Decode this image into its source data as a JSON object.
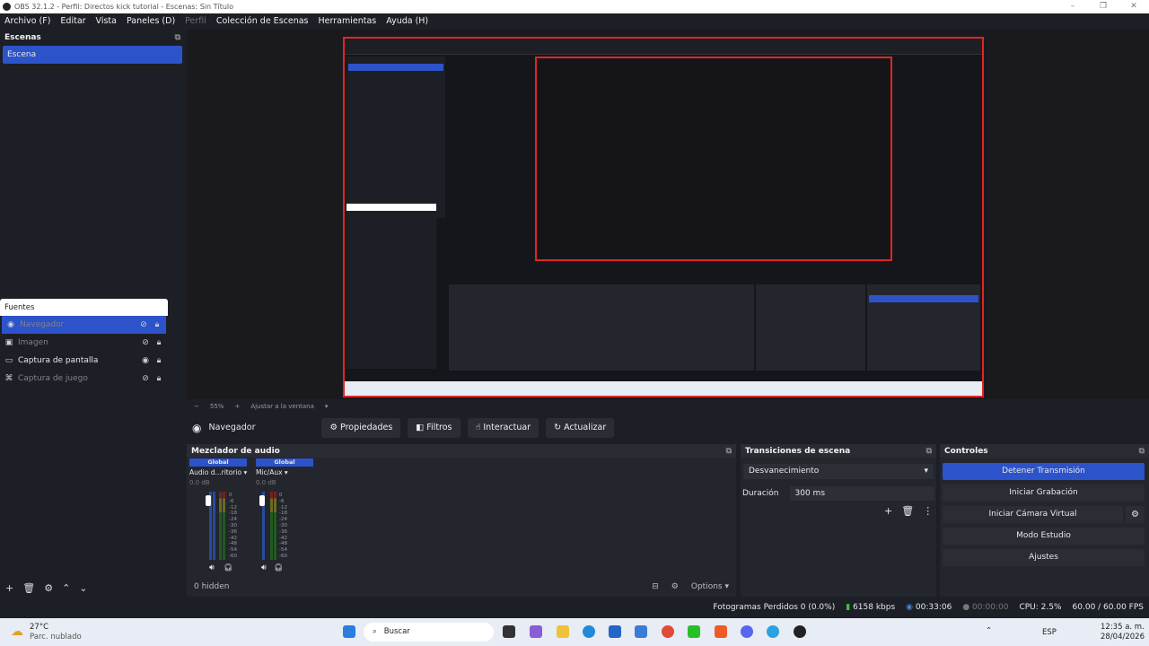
{
  "window": {
    "title": "OBS 32.1.2 - Perfil: Directos kick tutorial - Escenas: Sin Título",
    "controls": [
      "–",
      "❐",
      "✕"
    ]
  },
  "menu": {
    "items": [
      "Archivo (F)",
      "Editar",
      "Vista",
      "Paneles (D)",
      "Perfil",
      "Colección de Escenas",
      "Herramientas",
      "Ayuda (H)"
    ]
  },
  "scenes": {
    "header": "Escenas",
    "items": [
      "Escena"
    ]
  },
  "sources": {
    "header": "Fuentes",
    "items": [
      {
        "label": "Navegador",
        "selected": true,
        "visible": false
      },
      {
        "label": "Imagen",
        "selected": false,
        "visible": false
      },
      {
        "label": "Captura de pantalla",
        "selected": false,
        "visible": true
      },
      {
        "label": "Captura de juego",
        "selected": false,
        "visible": false
      }
    ]
  },
  "preview_toolbar": {
    "zoom_minus": "−",
    "zoom": "55%",
    "zoom_plus": "+",
    "fit": "Ajustar a la ventana"
  },
  "source_bar": {
    "name": "Navegador",
    "properties": "Propiedades",
    "filters": "Filtros",
    "interact": "Interactuar",
    "refresh": "Actualizar"
  },
  "mixer": {
    "header": "Mezclador de audio",
    "channels": [
      {
        "badge": "Global",
        "name": "Audio d...ritorio",
        "db": "0.0 dB"
      },
      {
        "badge": "Global",
        "name": "Mic/Aux",
        "db": "0.0 dB"
      }
    ],
    "scale": [
      "0",
      "-6",
      "-12",
      "-18",
      "-24",
      "-30",
      "-36",
      "-42",
      "-48",
      "-54",
      "-60"
    ],
    "hidden": "0 hidden",
    "options": "Options"
  },
  "transitions": {
    "header": "Transiciones de escena",
    "selected": "Desvanecimiento",
    "duration_label": "Duración",
    "duration_value": "300 ms"
  },
  "controls": {
    "header": "Controles",
    "buttons": [
      "Detener Transmisión",
      "Iniciar Grabación",
      "Iniciar Cámara Virtual",
      "Modo Estudio",
      "Ajustes"
    ]
  },
  "status": {
    "dropped": "Fotogramas Perdidos 0 (0.0%)",
    "bitrate": "6158 kbps",
    "stream_time": "00:33:06",
    "rec_time": "00:00:00",
    "cpu": "CPU: 2.5%",
    "fps": "60.00 / 60.00 FPS"
  },
  "taskbar": {
    "temp": "27°C",
    "weather": "Parc. nublado",
    "search": "Buscar",
    "lang": "ESP",
    "time": "12:35 a. m.",
    "date": "28/04/2026"
  },
  "colors": {
    "accent": "#2c53c9",
    "live_border": "#e02525",
    "bg": "#1d1f26"
  }
}
